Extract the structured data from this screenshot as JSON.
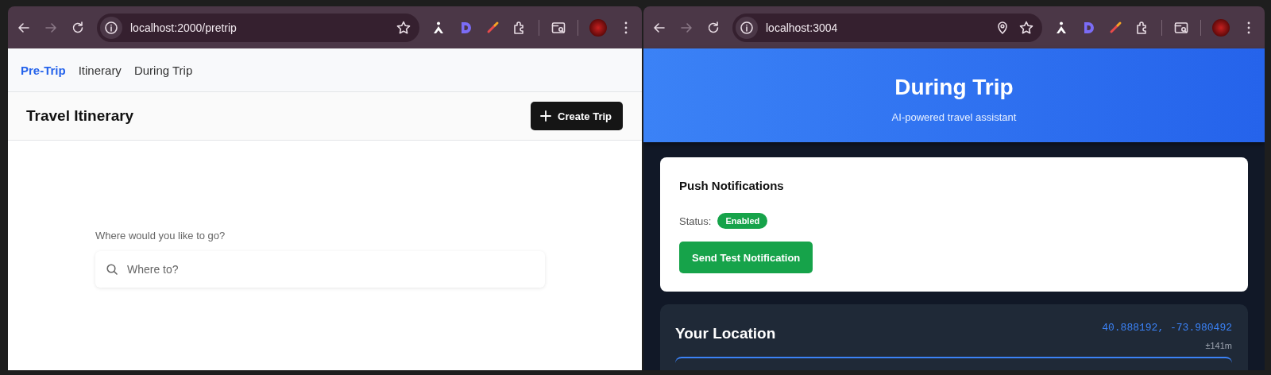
{
  "left_window": {
    "address": "localhost:2000/pretrip",
    "location_in_use": false,
    "nav": [
      {
        "label": "Pre-Trip",
        "selected": true
      },
      {
        "label": "Itinerary",
        "selected": false
      },
      {
        "label": "During Trip",
        "selected": false
      }
    ],
    "title": "Travel Itinerary",
    "create_button": "Create Trip",
    "prompt": "Where would you like to go?",
    "search": {
      "placeholder": "Where to?"
    }
  },
  "right_window": {
    "address": "localhost:3004",
    "location_in_use": true,
    "header": {
      "title": "During Trip",
      "subtitle": "AI-powered travel assistant"
    },
    "notifications": {
      "title": "Push Notifications",
      "status_label": "Status:",
      "status": "Enabled",
      "enabled": true,
      "button": "Send Test Notification"
    },
    "location": {
      "title": "Your Location",
      "coordinates": "40.888192, -73.980492",
      "accuracy": "±141m"
    }
  }
}
